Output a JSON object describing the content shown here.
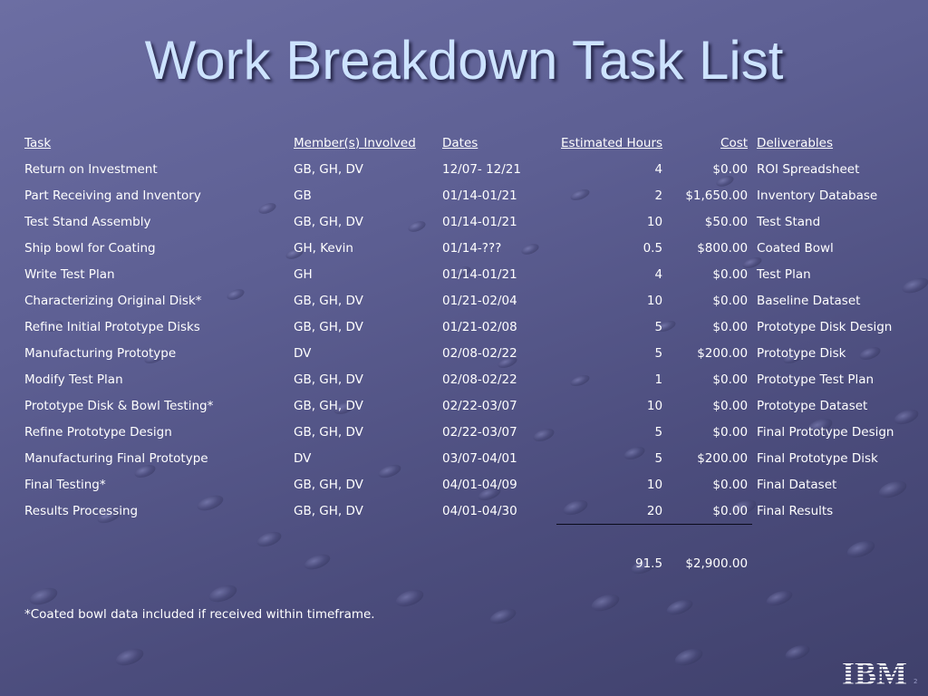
{
  "slide": {
    "title": "Work Breakdown Task List",
    "slide_number": "2"
  },
  "table": {
    "headers": {
      "task": "Task",
      "members": "Member(s) Involved",
      "dates": "Dates",
      "hours": "Estimated Hours",
      "cost": "Cost",
      "deliverables": "Deliverables"
    },
    "rows": [
      {
        "task": "Return on Investment",
        "members": "GB, GH, DV",
        "dates": "12/07- 12/21",
        "hours": "4",
        "cost": "$0.00",
        "deliverables": "ROI Spreadsheet"
      },
      {
        "task": "Part Receiving and Inventory",
        "members": "GB",
        "dates": "01/14-01/21",
        "hours": "2",
        "cost": "$1,650.00",
        "deliverables": "Inventory Database"
      },
      {
        "task": "Test Stand Assembly",
        "members": "GB, GH, DV",
        "dates": "01/14-01/21",
        "hours": "10",
        "cost": "$50.00",
        "deliverables": "Test Stand"
      },
      {
        "task": "Ship bowl for Coating",
        "members": "GH, Kevin",
        "dates": "01/14-???",
        "hours": "0.5",
        "cost": "$800.00",
        "deliverables": "Coated Bowl"
      },
      {
        "task": "Write Test Plan",
        "members": "GH",
        "dates": "01/14-01/21",
        "hours": "4",
        "cost": "$0.00",
        "deliverables": "Test Plan"
      },
      {
        "task": "Characterizing Original Disk*",
        "members": "GB, GH, DV",
        "dates": "01/21-02/04",
        "hours": "10",
        "cost": "$0.00",
        "deliverables": "Baseline Dataset"
      },
      {
        "task": "Refine Initial Prototype Disks",
        "members": "GB, GH, DV",
        "dates": "01/21-02/08",
        "hours": "5",
        "cost": "$0.00",
        "deliverables": "Prototype Disk Design"
      },
      {
        "task": "Manufacturing Prototype",
        "members": "DV",
        "dates": "02/08-02/22",
        "hours": "5",
        "cost": "$200.00",
        "deliverables": "Prototype Disk"
      },
      {
        "task": "Modify Test Plan",
        "members": "GB, GH, DV",
        "dates": "02/08-02/22",
        "hours": "1",
        "cost": "$0.00",
        "deliverables": "Prototype Test Plan"
      },
      {
        "task": "Prototype Disk & Bowl Testing*",
        "members": "GB, GH, DV",
        "dates": "02/22-03/07",
        "hours": "10",
        "cost": "$0.00",
        "deliverables": "Prototype Dataset"
      },
      {
        "task": "Refine Prototype Design",
        "members": "GB, GH, DV",
        "dates": "02/22-03/07",
        "hours": "5",
        "cost": "$0.00",
        "deliverables": "Final Prototype Design"
      },
      {
        "task": "Manufacturing Final Prototype",
        "members": "DV",
        "dates": "03/07-04/01",
        "hours": "5",
        "cost": "$200.00",
        "deliverables": "Final Prototype Disk"
      },
      {
        "task": "Final Testing*",
        "members": "GB, GH, DV",
        "dates": "04/01-04/09",
        "hours": "10",
        "cost": "$0.00",
        "deliverables": "Final Dataset"
      },
      {
        "task": "Results Processing",
        "members": "GB, GH, DV",
        "dates": "04/01-04/30",
        "hours": "20",
        "cost": "$0.00",
        "deliverables": "Final Results"
      }
    ],
    "totals": {
      "hours": "91.5",
      "cost": "$2,900.00"
    }
  },
  "footnote": "*Coated bowl data included if received within timeframe.",
  "logo": {
    "text": "IBM",
    "icon": "ibm-logo"
  },
  "colors": {
    "background": "#5d5f93",
    "title": "#cde3ff",
    "text": "#ffffff"
  }
}
